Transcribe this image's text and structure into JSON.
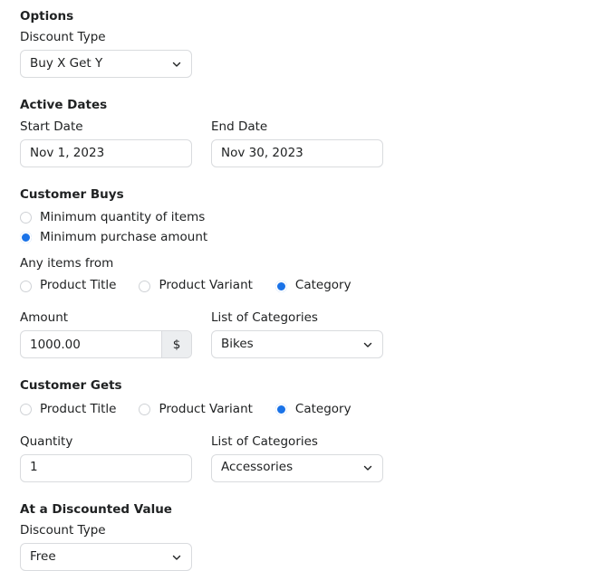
{
  "theme": {
    "accent": "#1a73e8",
    "border": "#d9dbde",
    "text": "#202223",
    "suffix_bg": "#eceef0",
    "background": "#ffffff"
  },
  "sections": {
    "options": {
      "heading": "Options",
      "discount_type": {
        "label": "Discount Type",
        "value": "Buy X Get Y"
      }
    },
    "active_dates": {
      "heading": "Active Dates",
      "start_date": {
        "label": "Start Date",
        "value": "Nov 1, 2023"
      },
      "end_date": {
        "label": "End Date",
        "value": "Nov 30, 2023"
      }
    },
    "customer_buys": {
      "heading": "Customer Buys",
      "requirement_options": [
        {
          "label": "Minimum quantity of items",
          "checked": false
        },
        {
          "label": "Minimum purchase amount",
          "checked": true
        }
      ],
      "items_from_label": "Any items from",
      "items_from_options": [
        {
          "label": "Product Title",
          "checked": false
        },
        {
          "label": "Product Variant",
          "checked": false
        },
        {
          "label": "Category",
          "checked": true
        }
      ],
      "amount": {
        "label": "Amount",
        "value": "1000.00",
        "suffix": "$"
      },
      "categories": {
        "label": "List of Categories",
        "value": "Bikes"
      }
    },
    "customer_gets": {
      "heading": "Customer Gets",
      "items_from_options": [
        {
          "label": "Product Title",
          "checked": false
        },
        {
          "label": "Product Variant",
          "checked": false
        },
        {
          "label": "Category",
          "checked": true
        }
      ],
      "quantity": {
        "label": "Quantity",
        "value": "1"
      },
      "categories": {
        "label": "List of Categories",
        "value": "Accessories"
      }
    },
    "discounted_value": {
      "heading": "At a Discounted Value",
      "discount_type": {
        "label": "Discount Type",
        "value": "Free"
      }
    }
  }
}
